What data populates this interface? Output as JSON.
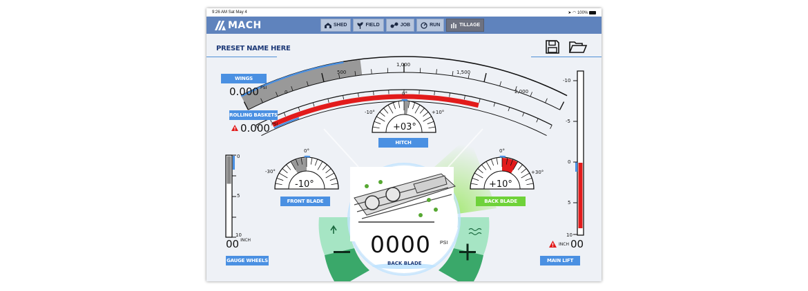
{
  "status": {
    "time": "9:26 AM  Sat May 4",
    "battery": "100%"
  },
  "header": {
    "brand": "MACH"
  },
  "nav": [
    {
      "label": "SHED",
      "icon": "shed-icon"
    },
    {
      "label": "FIELD",
      "icon": "field-icon"
    },
    {
      "label": "JOB",
      "icon": "job-icon"
    },
    {
      "label": "RUN",
      "icon": "run-icon"
    },
    {
      "label": "TILLAGE",
      "icon": "tillage-icon",
      "active": true
    }
  ],
  "preset": {
    "name": "PRESET NAME HERE"
  },
  "toolbar": {
    "save_icon": "save-icon",
    "open_icon": "folder-open-icon"
  },
  "pressure_gauge": {
    "ticks": [
      "0",
      "500",
      "1,000",
      "1,500",
      "2,000"
    ],
    "min": 0,
    "max": 2000,
    "value": 1500,
    "marker": 950
  },
  "wings": {
    "label": "WINGS",
    "value": "0.000",
    "unit": "PSI"
  },
  "rolling_baskets": {
    "label": "ROLLING BASKETS",
    "value": "0.000",
    "unit": "PSI"
  },
  "hitch": {
    "label": "HITCH",
    "value": "+03°",
    "top": "0°",
    "left": "-10°",
    "right": "+10°"
  },
  "front_blade": {
    "label": "FRONT BLADE",
    "value": "-10°",
    "top": "0°",
    "left": "-30°"
  },
  "back_blade": {
    "label": "BACK BLADE",
    "value": "+10°",
    "top": "0°",
    "right": "+30°"
  },
  "gauge_wheels": {
    "label": "GAUGE WHEELS",
    "value": "00",
    "unit": "INCH",
    "ticks": [
      "0",
      "5",
      "10"
    ]
  },
  "main_lift": {
    "label": "MAIN LIFT",
    "value": "00",
    "unit": "INCH",
    "ticks": [
      "-10",
      "-5",
      "0",
      "5",
      "10"
    ]
  },
  "center": {
    "value": "0000",
    "unit": "PSI",
    "label": "BACK BLADE"
  },
  "colors": {
    "header": "#5f83bd",
    "accent": "#4a90e2",
    "red": "#e21b1b",
    "green": "#6fd23a"
  }
}
